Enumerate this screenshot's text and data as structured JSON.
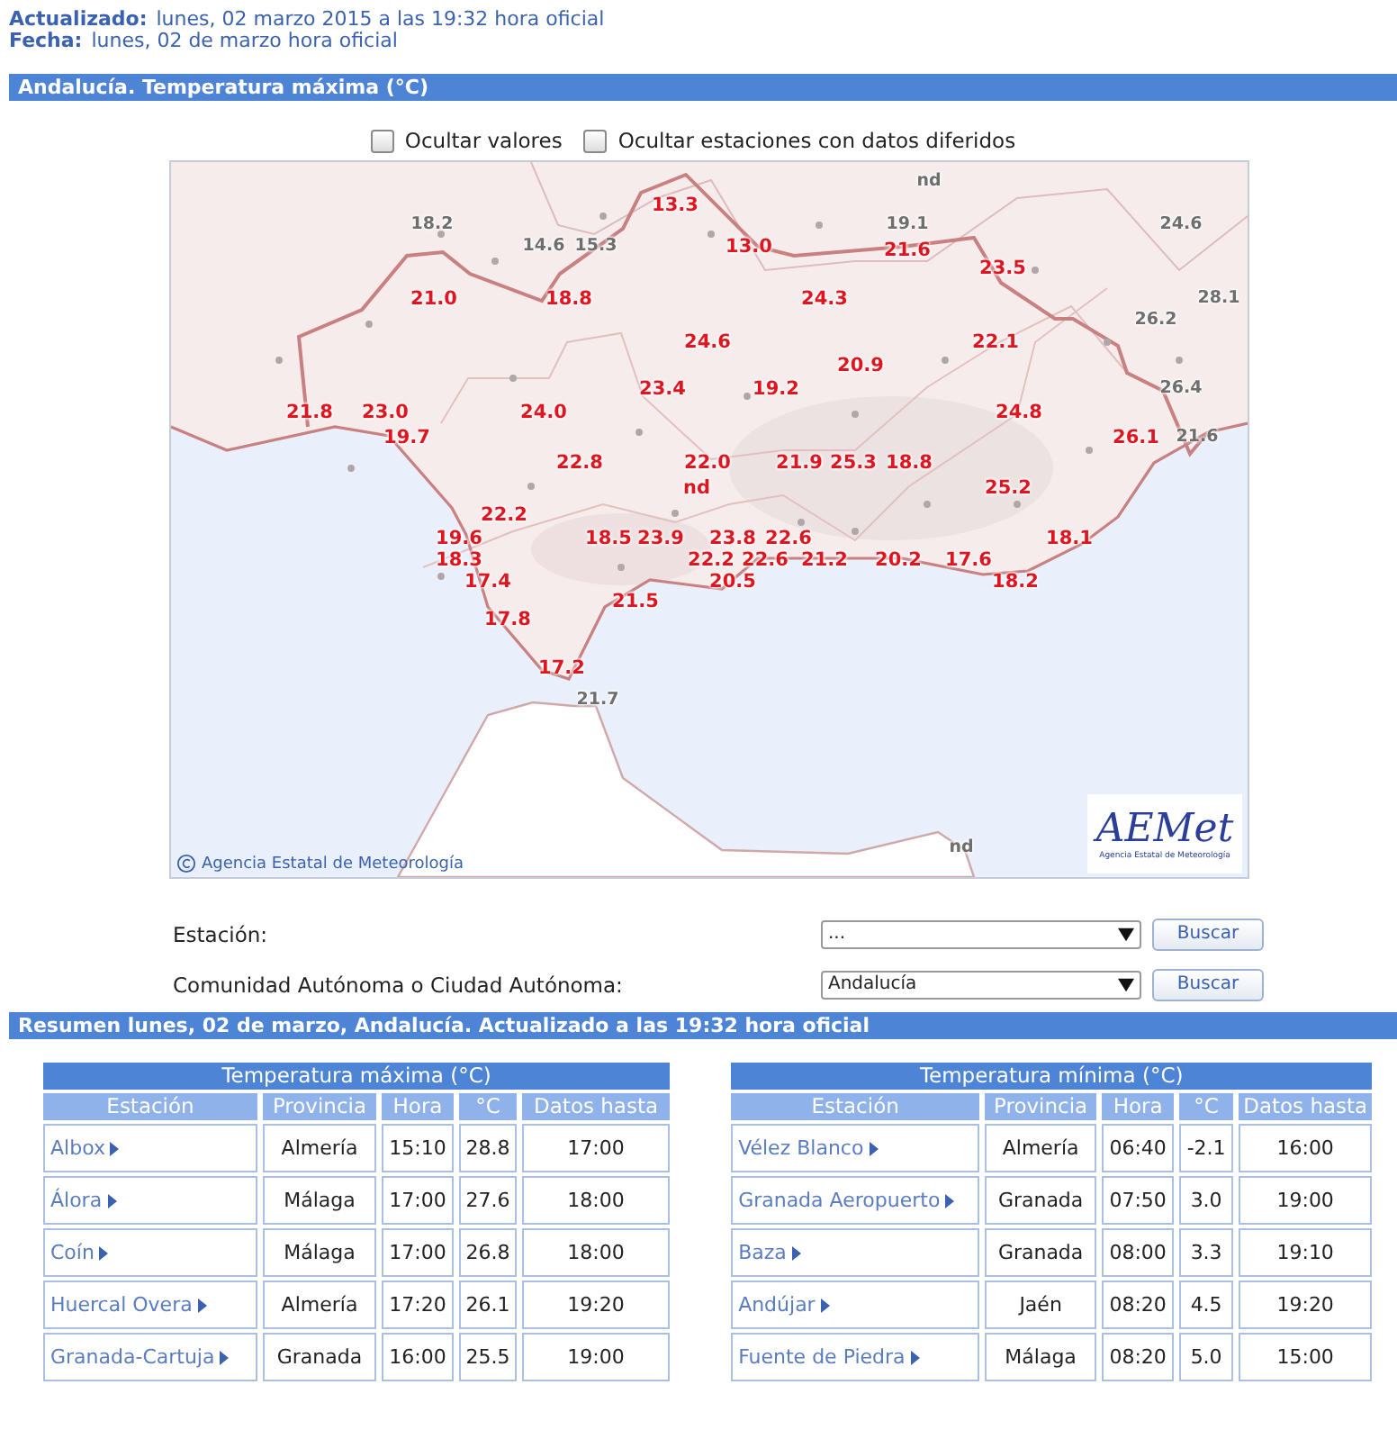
{
  "header": {
    "updated_label": "Actualizado:",
    "updated_value": "lunes, 02 marzo 2015 a las 19:32 hora oficial",
    "date_label": "Fecha:",
    "date_value": "lunes, 02 de marzo hora oficial"
  },
  "map_section": {
    "title": "Andalucía. Temperatura máxima (°C)",
    "options": [
      {
        "label": "Ocultar valores",
        "checked": false
      },
      {
        "label": "Ocultar estaciones con datos diferidos",
        "checked": false
      }
    ],
    "map": {
      "kind": "picture",
      "credit": "Agencia Estatal de Meteorología",
      "logo": {
        "name": "AEMet",
        "subtitle": "Agencia Estatal de Meteorología"
      },
      "stations": [
        {
          "value": "nd",
          "kind": "outside"
        },
        {
          "value": "13.3",
          "kind": "inside"
        },
        {
          "value": "18.2",
          "kind": "outside"
        },
        {
          "value": "19.1",
          "kind": "outside"
        },
        {
          "value": "24.6",
          "kind": "outside"
        },
        {
          "value": "14.6",
          "kind": "outside"
        },
        {
          "value": "15.3",
          "kind": "outside"
        },
        {
          "value": "13.0",
          "kind": "inside"
        },
        {
          "value": "21.6",
          "kind": "inside"
        },
        {
          "value": "23.5",
          "kind": "inside"
        },
        {
          "value": "21.0",
          "kind": "inside"
        },
        {
          "value": "18.8",
          "kind": "inside"
        },
        {
          "value": "24.3",
          "kind": "inside"
        },
        {
          "value": "28.1",
          "kind": "outside"
        },
        {
          "value": "26.2",
          "kind": "outside"
        },
        {
          "value": "24.6",
          "kind": "inside"
        },
        {
          "value": "22.1",
          "kind": "inside"
        },
        {
          "value": "20.9",
          "kind": "inside"
        },
        {
          "value": "23.4",
          "kind": "inside"
        },
        {
          "value": "19.2",
          "kind": "inside"
        },
        {
          "value": "26.4",
          "kind": "outside"
        },
        {
          "value": "21.8",
          "kind": "inside"
        },
        {
          "value": "23.0",
          "kind": "inside"
        },
        {
          "value": "24.0",
          "kind": "inside"
        },
        {
          "value": "24.8",
          "kind": "inside"
        },
        {
          "value": "19.7",
          "kind": "inside"
        },
        {
          "value": "26.1",
          "kind": "inside"
        },
        {
          "value": "21.6",
          "kind": "outside"
        },
        {
          "value": "22.8",
          "kind": "inside"
        },
        {
          "value": "22.0",
          "kind": "inside"
        },
        {
          "value": "21.9",
          "kind": "inside"
        },
        {
          "value": "25.3",
          "kind": "inside"
        },
        {
          "value": "18.8",
          "kind": "inside"
        },
        {
          "value": "nd",
          "kind": "inside"
        },
        {
          "value": "25.2",
          "kind": "inside"
        },
        {
          "value": "22.2",
          "kind": "inside"
        },
        {
          "value": "19.6",
          "kind": "inside"
        },
        {
          "value": "18.5",
          "kind": "inside"
        },
        {
          "value": "23.9",
          "kind": "inside"
        },
        {
          "value": "23.8",
          "kind": "inside"
        },
        {
          "value": "22.6",
          "kind": "inside"
        },
        {
          "value": "18.1",
          "kind": "inside"
        },
        {
          "value": "18.3",
          "kind": "inside"
        },
        {
          "value": "22.2",
          "kind": "inside"
        },
        {
          "value": "22.6",
          "kind": "inside"
        },
        {
          "value": "21.2",
          "kind": "inside"
        },
        {
          "value": "20.2",
          "kind": "inside"
        },
        {
          "value": "17.6",
          "kind": "inside"
        },
        {
          "value": "17.4",
          "kind": "inside"
        },
        {
          "value": "20.5",
          "kind": "inside"
        },
        {
          "value": "18.2",
          "kind": "inside"
        },
        {
          "value": "21.5",
          "kind": "inside"
        },
        {
          "value": "17.8",
          "kind": "inside"
        },
        {
          "value": "17.2",
          "kind": "inside"
        },
        {
          "value": "21.7",
          "kind": "outside"
        },
        {
          "value": "nd",
          "kind": "outside"
        }
      ]
    }
  },
  "filters": [
    {
      "label": "Estación:",
      "value": "...",
      "button": "Buscar"
    },
    {
      "label": "Comunidad Autónoma o Ciudad Autónoma:",
      "value": "Andalucía",
      "button": "Buscar"
    }
  ],
  "summary": {
    "title": "Resumen lunes, 02 de marzo, Andalucía. Actualizado a las 19:32 hora oficial",
    "tables": [
      {
        "title": "Temperatura máxima (°C)",
        "columns": [
          "Estación",
          "Provincia",
          "Hora",
          "°C",
          "Datos hasta"
        ],
        "rows": [
          [
            "Albox",
            "Almería",
            "15:10",
            "28.8",
            "17:00"
          ],
          [
            "Álora",
            "Málaga",
            "17:00",
            "27.6",
            "18:00"
          ],
          [
            "Coín",
            "Málaga",
            "17:00",
            "26.8",
            "18:00"
          ],
          [
            "Huercal Overa",
            "Almería",
            "17:20",
            "26.1",
            "19:20"
          ],
          [
            "Granada-Cartuja",
            "Granada",
            "16:00",
            "25.5",
            "19:00"
          ]
        ]
      },
      {
        "title": "Temperatura mínima (°C)",
        "columns": [
          "Estación",
          "Provincia",
          "Hora",
          "°C",
          "Datos hasta"
        ],
        "rows": [
          [
            "Vélez Blanco",
            "Almería",
            "06:40",
            "-2.1",
            "16:00"
          ],
          [
            "Granada Aeropuerto",
            "Granada",
            "07:50",
            "3.0",
            "19:00"
          ],
          [
            "Baza",
            "Granada",
            "08:00",
            "3.3",
            "19:10"
          ],
          [
            "Andújar",
            "Jaén",
            "08:20",
            "4.5",
            "19:20"
          ],
          [
            "Fuente de Piedra",
            "Málaga",
            "08:20",
            "5.0",
            "15:00"
          ]
        ]
      }
    ]
  }
}
